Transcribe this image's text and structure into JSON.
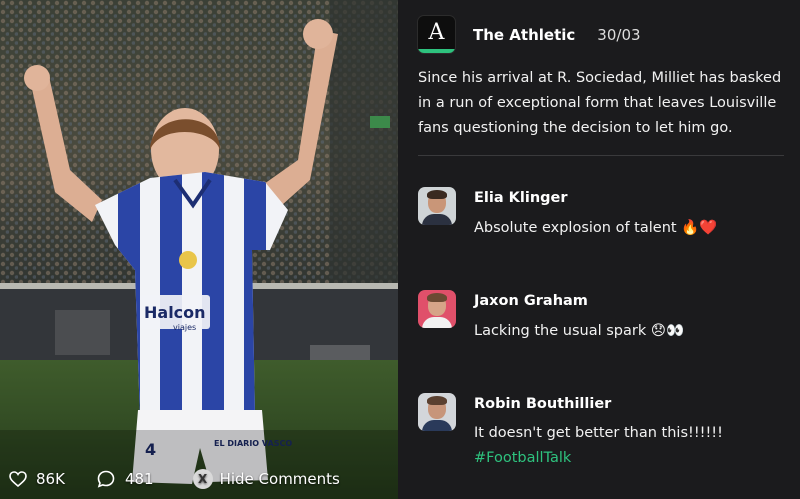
{
  "post": {
    "source": "The Athletic",
    "logo_letter": "A",
    "date": "30/03",
    "text": "Since his arrival at R. Sociedad, Milliet has basked in a run of exceptional form that leaves Louisville fans questioning the decision to let him go."
  },
  "comments": [
    {
      "name": "Elia Klinger",
      "text": "Absolute explosion of talent 🔥❤️"
    },
    {
      "name": "Jaxon Graham",
      "text": "Lacking the usual spark 😞👀"
    },
    {
      "name": "Robin Bouthillier",
      "text": "It doesn't get better than this!!!!!!",
      "hashtag": "#FootballTalk"
    }
  ],
  "stats": {
    "likes": "86K",
    "comments": "481",
    "hide_label": "Hide Comments",
    "hide_key": "X"
  },
  "photo": {
    "jersey_sponsor": "Halcon",
    "jersey_sponsor_sub": "viajes",
    "shorts_sponsor": "EL DIARIO VASCO",
    "shirt_number": "4"
  },
  "icons": {
    "likes": "heart-icon",
    "comments": "comment-bubble-icon",
    "hide": "x-button-icon"
  },
  "colors": {
    "panel_bg": "#1b1b1d",
    "accent_green": "#2ec27e",
    "jersey_blue": "#2b45a6"
  }
}
